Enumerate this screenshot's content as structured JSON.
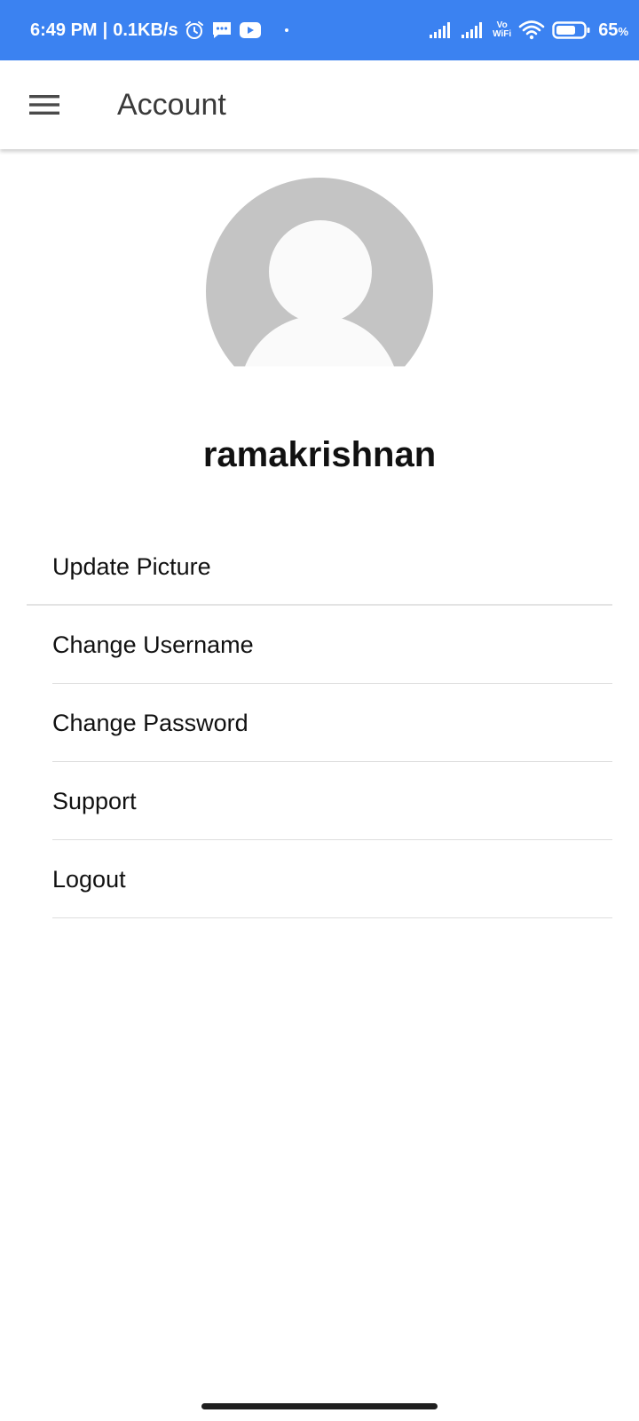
{
  "status_bar": {
    "time": "6:49 PM",
    "separator": "|",
    "network_speed": "0.1KB/s",
    "vowifi_top": "Vo",
    "vowifi_bottom": "WiFi",
    "battery": "65",
    "battery_unit": "%",
    "background_color": "#3b82f1",
    "icons": [
      "alarm-icon",
      "message-icon",
      "youtube-icon",
      "signal-icon",
      "signal-icon",
      "vowifi-icon",
      "wifi-icon",
      "battery-icon"
    ]
  },
  "app_bar": {
    "title": "Account",
    "menu_icon": "hamburger-menu-icon"
  },
  "profile": {
    "avatar_icon": "default-avatar-icon",
    "username": "ramakrishnan"
  },
  "menu": {
    "items": [
      {
        "label": "Update Picture"
      },
      {
        "label": "Change Username"
      },
      {
        "label": "Change Password"
      },
      {
        "label": "Support"
      },
      {
        "label": "Logout"
      }
    ]
  }
}
